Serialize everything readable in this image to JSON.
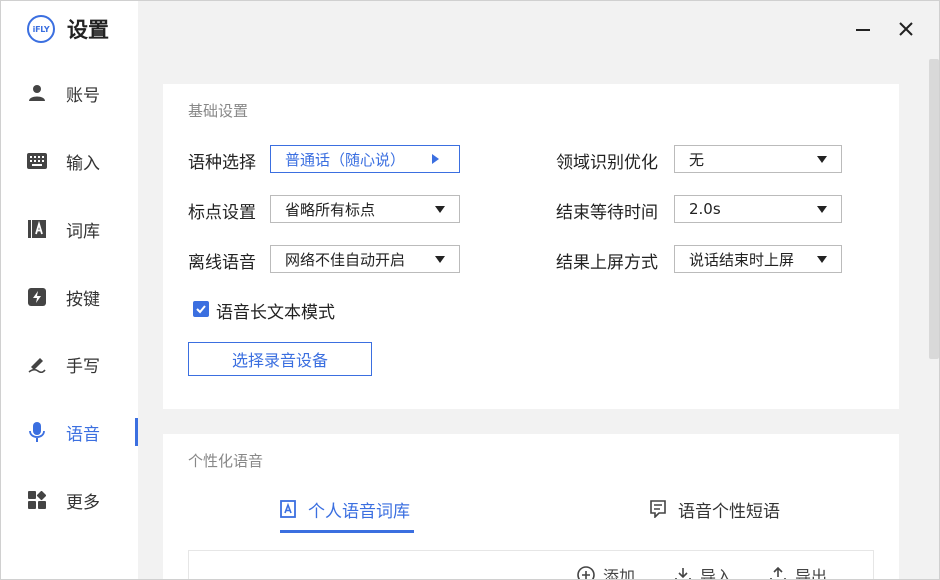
{
  "app": {
    "title": "设置",
    "logo_text": "iFLY"
  },
  "sidebar": {
    "items": [
      {
        "label": "账号",
        "icon": "user-icon"
      },
      {
        "label": "输入",
        "icon": "keyboard-icon"
      },
      {
        "label": "词库",
        "icon": "dictionary-icon"
      },
      {
        "label": "按键",
        "icon": "key-icon"
      },
      {
        "label": "手写",
        "icon": "pen-icon"
      },
      {
        "label": "语音",
        "icon": "microphone-icon",
        "active": true
      },
      {
        "label": "更多",
        "icon": "more-grid-icon"
      }
    ]
  },
  "basic": {
    "title": "基础设置",
    "language_label": "语种选择",
    "language_value": "普通话（随心说）",
    "punct_label": "标点设置",
    "punct_value": "省略所有标点",
    "offline_label": "离线语音",
    "offline_value": "网络不佳自动开启",
    "domain_label": "领域识别优化",
    "domain_value": "无",
    "wait_label": "结束等待时间",
    "wait_value": "2.0s",
    "result_label": "结果上屏方式",
    "result_value": "说话结束时上屏",
    "longtext_label": "语音长文本模式",
    "longtext_checked": true,
    "device_button": "选择录音设备"
  },
  "personal": {
    "title": "个性化语音",
    "tab_dict": "个人语音词库",
    "tab_phrase": "语音个性短语",
    "add_label": "添加",
    "import_label": "导入",
    "export_label": "导出"
  },
  "colors": {
    "accent": "#3b6fe0",
    "background": "#f2f2f2",
    "card": "#ffffff"
  }
}
